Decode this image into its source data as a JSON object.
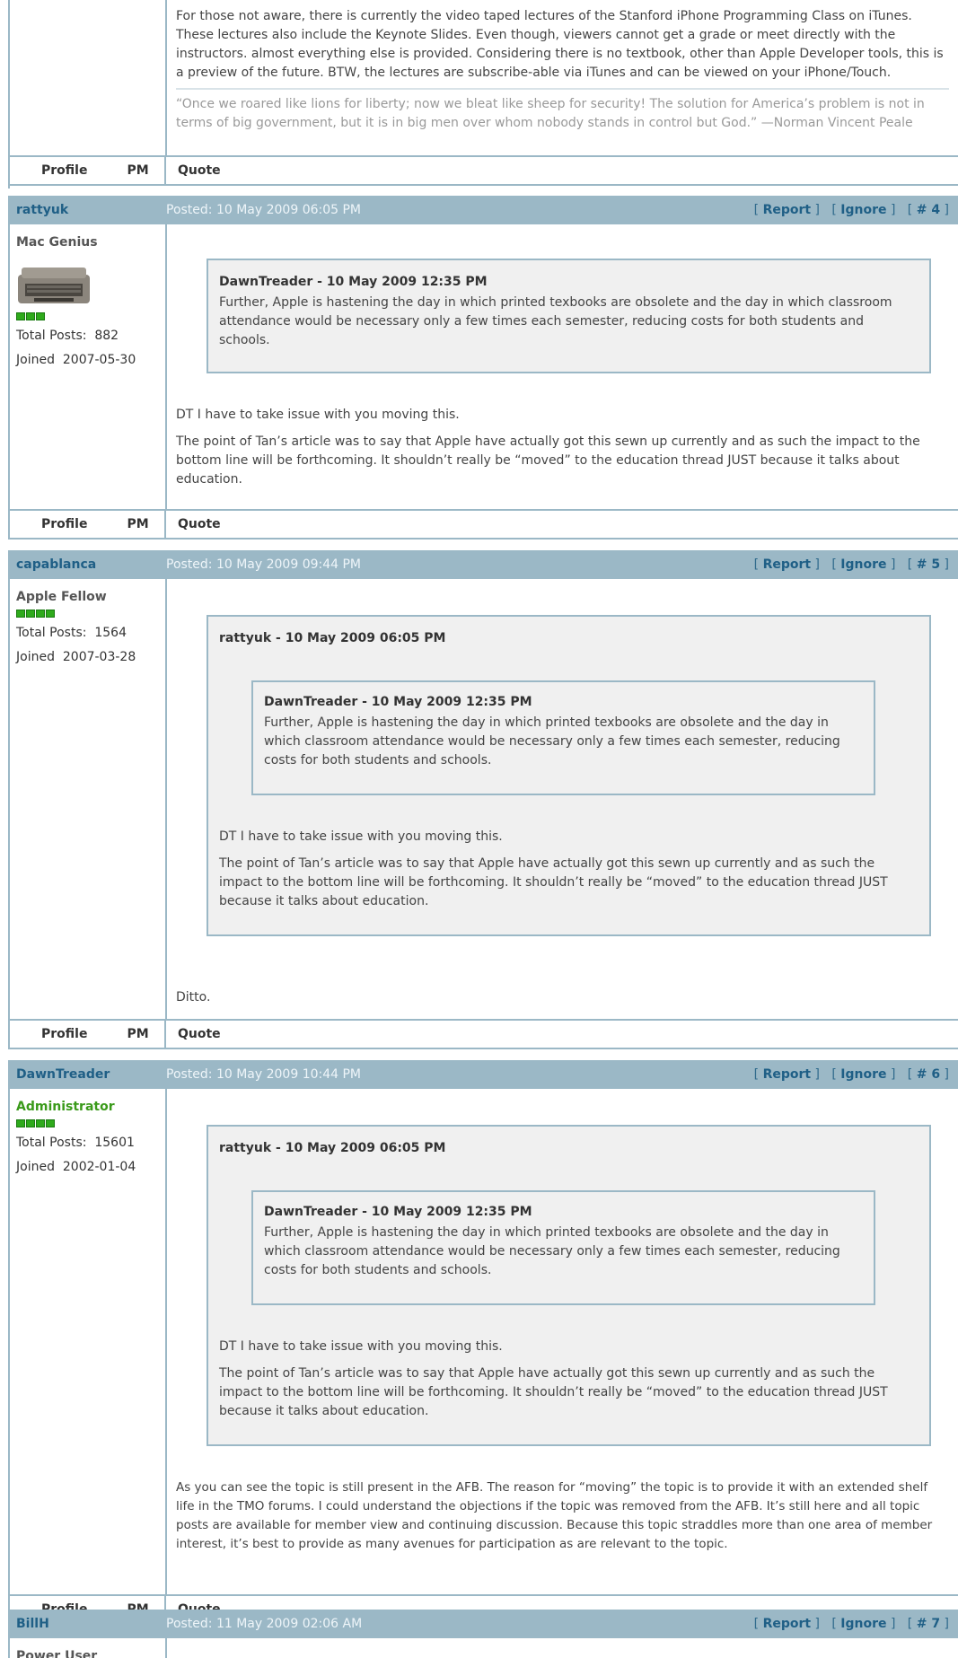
{
  "labels": {
    "profile": "Profile",
    "pm": "PM",
    "quote": "Quote",
    "report": "Report",
    "ignore": "Ignore",
    "total_posts": "Total Posts:",
    "joined": "Joined"
  },
  "post3": {
    "body": "For those not aware, there is currently the video taped lectures of the Stanford iPhone Programming Class on iTunes. These lectures also include the Keynote Slides. Even though, viewers cannot get a grade or meet directly with the instructors. almost everything else is provided. Considering there is no textbook, other than Apple Developer tools, this is a preview of the future.  BTW, the lectures are subscribe-able via iTunes and can be viewed on your iPhone/Touch.",
    "signature": "“Once we roared like lions for liberty; now we bleat like sheep for security! The solution for America’s problem is not in terms of big government, but it is in big men over whom nobody stands in control but God.”  —Norman Vincent Peale"
  },
  "post4": {
    "username": "rattyuk",
    "posted": "Posted: 10 May 2009 06:05 PM",
    "num": "# 4",
    "rank": "Mac Genius",
    "total_posts": "882",
    "joined": "2007-05-30",
    "quote_header": "DawnTreader - 10 May 2009 12:35 PM",
    "quote_text": "Further, Apple is hastening the day in which printed texbooks are obsolete and the day in which classroom attendance would be necessary only a few times each semester, reducing costs for both students and schools.",
    "p1": "DT I have to take issue with you moving this.",
    "p2": "The point of Tan’s article was to say that Apple have actually got this sewn up currently and as such the impact to the bottom line will be forthcoming. It shouldn’t really be “moved” to the education thread JUST because it talks about education."
  },
  "post5": {
    "username": "capablanca",
    "posted": "Posted: 10 May 2009 09:44 PM",
    "num": "# 5",
    "rank": "Apple Fellow",
    "total_posts": "1564",
    "joined": "2007-03-28",
    "outer_header": "rattyuk - 10 May 2009 06:05 PM",
    "inner_header": "DawnTreader - 10 May 2009 12:35 PM",
    "inner_text": "Further, Apple is hastening the day in which printed texbooks are obsolete and the day in which classroom attendance would be necessary only a few times each semester, reducing costs for both students and schools.",
    "q1": "DT I have to take issue with you moving this.",
    "q2": "The point of Tan’s article was to say that Apple have actually got this sewn up currently and as such the impact to the bottom line will be forthcoming. It shouldn’t really be “moved” to the education thread JUST because it talks about education.",
    "reply": "Ditto."
  },
  "post6": {
    "username": "DawnTreader",
    "posted": "Posted: 10 May 2009 10:44 PM",
    "num": "# 6",
    "rank": "Administrator",
    "total_posts": "15601",
    "joined": "2002-01-04",
    "outer_header": "rattyuk - 10 May 2009 06:05 PM",
    "inner_header": "DawnTreader - 10 May 2009 12:35 PM",
    "inner_text": "Further, Apple is hastening the day in which printed texbooks are obsolete and the day in which classroom attendance would be necessary only a few times each semester, reducing costs for both students and schools.",
    "q1": "DT I have to take issue with you moving this.",
    "q2": "The point of Tan’s article was to say that Apple have actually got this sewn up currently and as such the impact to the bottom line will be forthcoming. It shouldn’t really be “moved” to the education thread JUST because it talks about education.",
    "reply": "As you can see the topic is still present in the AFB. The reason for “moving” the topic is to provide it with an extended shelf life in the TMO forums. I could understand the objections if the topic was removed from the AFB. It’s still here and all topic posts are available for member view and continuing discussion. Because this topic straddles more than one area of member interest, it’s best to provide as many avenues for participation as are relevant to the topic."
  },
  "post7": {
    "username": "BillH",
    "posted": "Posted: 11 May 2009 02:06 AM",
    "num": "# 7",
    "rank": "Power User"
  },
  "colors": {
    "header_bg": "#9bb8c6",
    "link": "#1f5f86",
    "admin": "#3a9a1a",
    "bar": "#2faa1c"
  }
}
